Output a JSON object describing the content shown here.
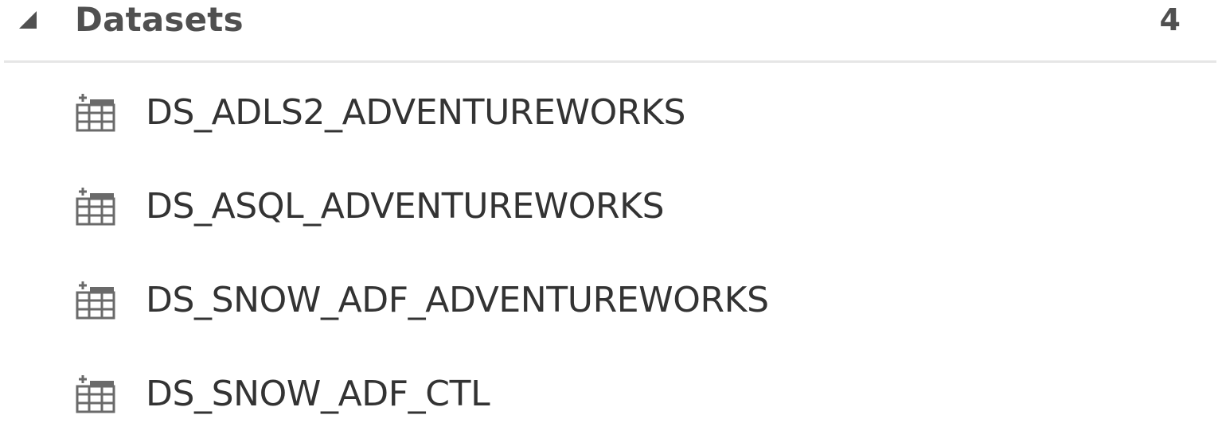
{
  "section": {
    "title": "Datasets",
    "count": "4",
    "expanded": true,
    "toggle_icon": "caret-expanded-icon"
  },
  "datasets": [
    {
      "label": "DS_ADLS2_ADVENTUREWORKS",
      "icon": "table-dataset-icon"
    },
    {
      "label": "DS_ASQL_ADVENTUREWORKS",
      "icon": "table-dataset-icon"
    },
    {
      "label": "DS_SNOW_ADF_ADVENTUREWORKS",
      "icon": "table-dataset-icon"
    },
    {
      "label": "DS_SNOW_ADF_CTL",
      "icon": "table-dataset-icon"
    }
  ],
  "colors": {
    "text": "#333333",
    "header_text": "#505050",
    "icon": "#6a6a6a",
    "divider": "#e6e6e6"
  }
}
